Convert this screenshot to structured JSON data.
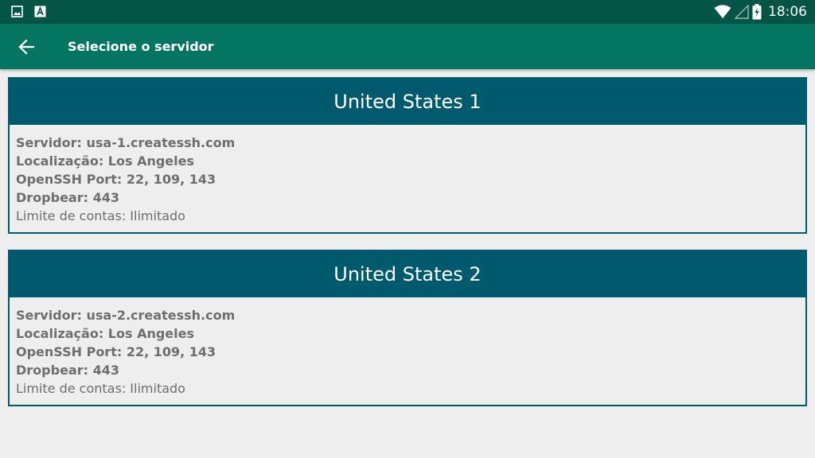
{
  "status_bar": {
    "time": "18:06",
    "left_icons": [
      "image-notification-icon",
      "app-notification-icon"
    ],
    "right_icons": [
      "wifi-icon",
      "cell-signal-icon",
      "battery-charging-icon"
    ]
  },
  "app_bar": {
    "back_icon": "arrow-back-icon",
    "title": "Selecione o servidor"
  },
  "servers": [
    {
      "name": "United States 1",
      "server_line": "Servidor: usa-1.createssh.com",
      "location_line": "Localização: Los Angeles",
      "openssh_line": "OpenSSH Port: 22, 109, 143",
      "dropbear_line": "Dropbear: 443",
      "limit_line": "Limite de contas: Ilimitado"
    },
    {
      "name": "United States 2",
      "server_line": "Servidor: usa-2.createssh.com",
      "location_line": "Localização: Los Angeles",
      "openssh_line": "OpenSSH Port: 22, 109, 143",
      "dropbear_line": "Dropbear: 443",
      "limit_line": "Limite de contas: Ilimitado"
    }
  ],
  "colors": {
    "status_bar": "#045545",
    "app_bar": "#047561",
    "card_header": "#005a6e",
    "background": "#eeeeee",
    "body_text": "#6e6e6e"
  }
}
